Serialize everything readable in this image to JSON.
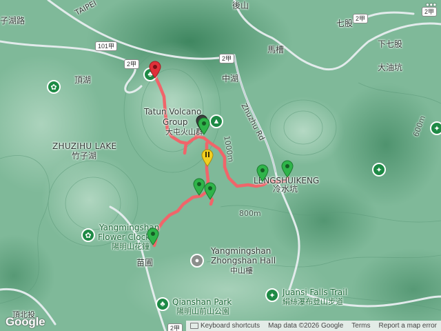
{
  "labels": {
    "top_road_left": "子湖路",
    "taipei": "TAIPEI",
    "houshan": "後山",
    "qigu": "七股",
    "xiaqigu": "下七股",
    "macao": "馬槽",
    "dayoukeng": "大油坑",
    "zhonghu": "中湖",
    "dinghu": "頂湖",
    "zhuzihu_en": "ZHUZIHU LAKE",
    "zhuzihu_zh": "竹子湖",
    "tatun_en_1": "Tatun Volcano",
    "tatun_en_2": "Group",
    "tatun_zh": "大屯火山群",
    "zhuzhu_rd": "Zhuzhu Rd",
    "lengshuikeng_en": "LENGSHUIKENG",
    "lengshuikeng_zh": "冷水坑",
    "ym_flower_en_1": "Yangmingshan",
    "ym_flower_en_2": "Flower Clock",
    "ym_flower_zh": "陽明山花鐘",
    "miaopu": "苗圃",
    "zhongshan_en_1": "Yangmingshan",
    "zhongshan_en_2": "Zhongshan Hall",
    "zhongshan_zh": "中山樓",
    "qianshan_en": "Qianshan Park",
    "qianshan_zh": "陽明山前山公園",
    "juansi_en": "Juansi Falls Trail",
    "juansi_zh": "絹絲瀑布登山步道",
    "dingbei": "頂北投",
    "elev_1000": "1000m",
    "elev_800": "800m",
    "elev_600": "600m"
  },
  "shields": {
    "s_101": "101甲",
    "s_2a": "2甲",
    "s_2_1": "2甲",
    "s_2_2": "2甲",
    "s_2_3": "2甲",
    "s_2_4": "2甲"
  },
  "footer": {
    "keyboard": "Keyboard shortcuts",
    "mapdata": "Map data ©2026 Google",
    "terms": "Terms",
    "report": "Report a map error"
  },
  "brand": {
    "google": "Google"
  },
  "colors": {
    "route": "#f0656a",
    "pin_green": "#2fb44a",
    "pin_red": "#e0313a",
    "pin_yellow": "#f2cf1f",
    "poi_green": "#1e8a45",
    "poi_grey": "#8b8f8c",
    "road": "#e8eef0"
  },
  "icons": {
    "start_pin": "red-map-pin",
    "waypoint_pin": "green-map-pin",
    "warning_pin": "yellow-warning-pin",
    "park": "park-flower-icon",
    "hiking": "hiker-icon",
    "landmark": "landmark-icon",
    "tree": "tree-icon"
  }
}
